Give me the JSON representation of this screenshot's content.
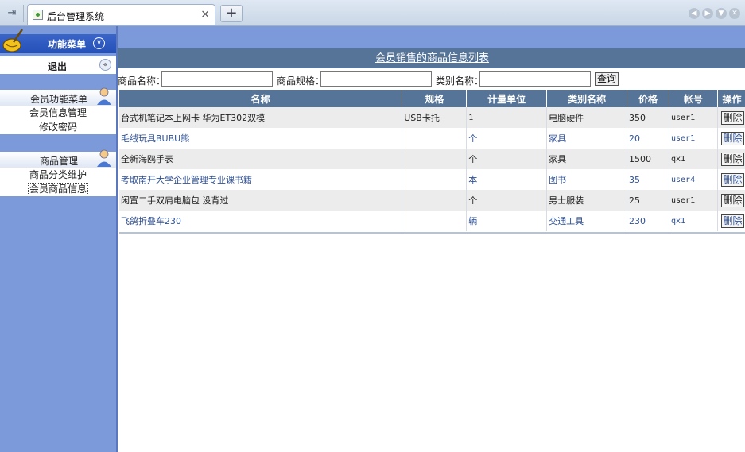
{
  "browser": {
    "tab_title": "后台管理系统",
    "tab_close": "×",
    "new_tab": "+"
  },
  "sidebar": {
    "menu_title": "功能菜单",
    "logout": "退出",
    "groups": [
      {
        "title": "会员功能菜单",
        "items": [
          "会员信息管理",
          "修改密码"
        ]
      },
      {
        "title": "商品管理",
        "items": [
          "商品分类维护",
          "会员商品信息"
        ]
      }
    ]
  },
  "main": {
    "title": "会员销售的商品信息列表",
    "search": {
      "name_label": "商品名称：",
      "spec_label": "商品规格：",
      "category_label": "类别名称：",
      "name_value": "",
      "spec_value": "",
      "category_value": "",
      "query_button": "查询"
    },
    "table": {
      "headers": [
        "名称",
        "规格",
        "计量单位",
        "类别名称",
        "价格",
        "帐号",
        "操作"
      ],
      "rows": [
        {
          "name": "台式机笔记本上网卡 华为ET302双模",
          "spec": "USB卡托",
          "unit": "1",
          "category": "电脑硬件",
          "price": "350",
          "account": "user1",
          "action": "删除"
        },
        {
          "name": "毛绒玩具BUBU熊",
          "spec": "",
          "unit": "个",
          "category": "家具",
          "price": "20",
          "account": "user1",
          "action": "删除"
        },
        {
          "name": "全新海鸥手表",
          "spec": "",
          "unit": "个",
          "category": "家具",
          "price": "1500",
          "account": "qx1",
          "action": "删除"
        },
        {
          "name": "考取南开大学企业管理专业课书籍",
          "spec": "",
          "unit": "本",
          "category": "图书",
          "price": "35",
          "account": "user4",
          "action": "删除"
        },
        {
          "name": "闲置二手双肩电脑包 没背过",
          "spec": "",
          "unit": "个",
          "category": "男士服装",
          "price": "25",
          "account": "user1",
          "action": "删除"
        },
        {
          "name": "飞鸽折叠车230",
          "spec": "",
          "unit": "辆",
          "category": "交通工具",
          "price": "230",
          "account": "qx1",
          "action": "删除"
        }
      ]
    }
  }
}
